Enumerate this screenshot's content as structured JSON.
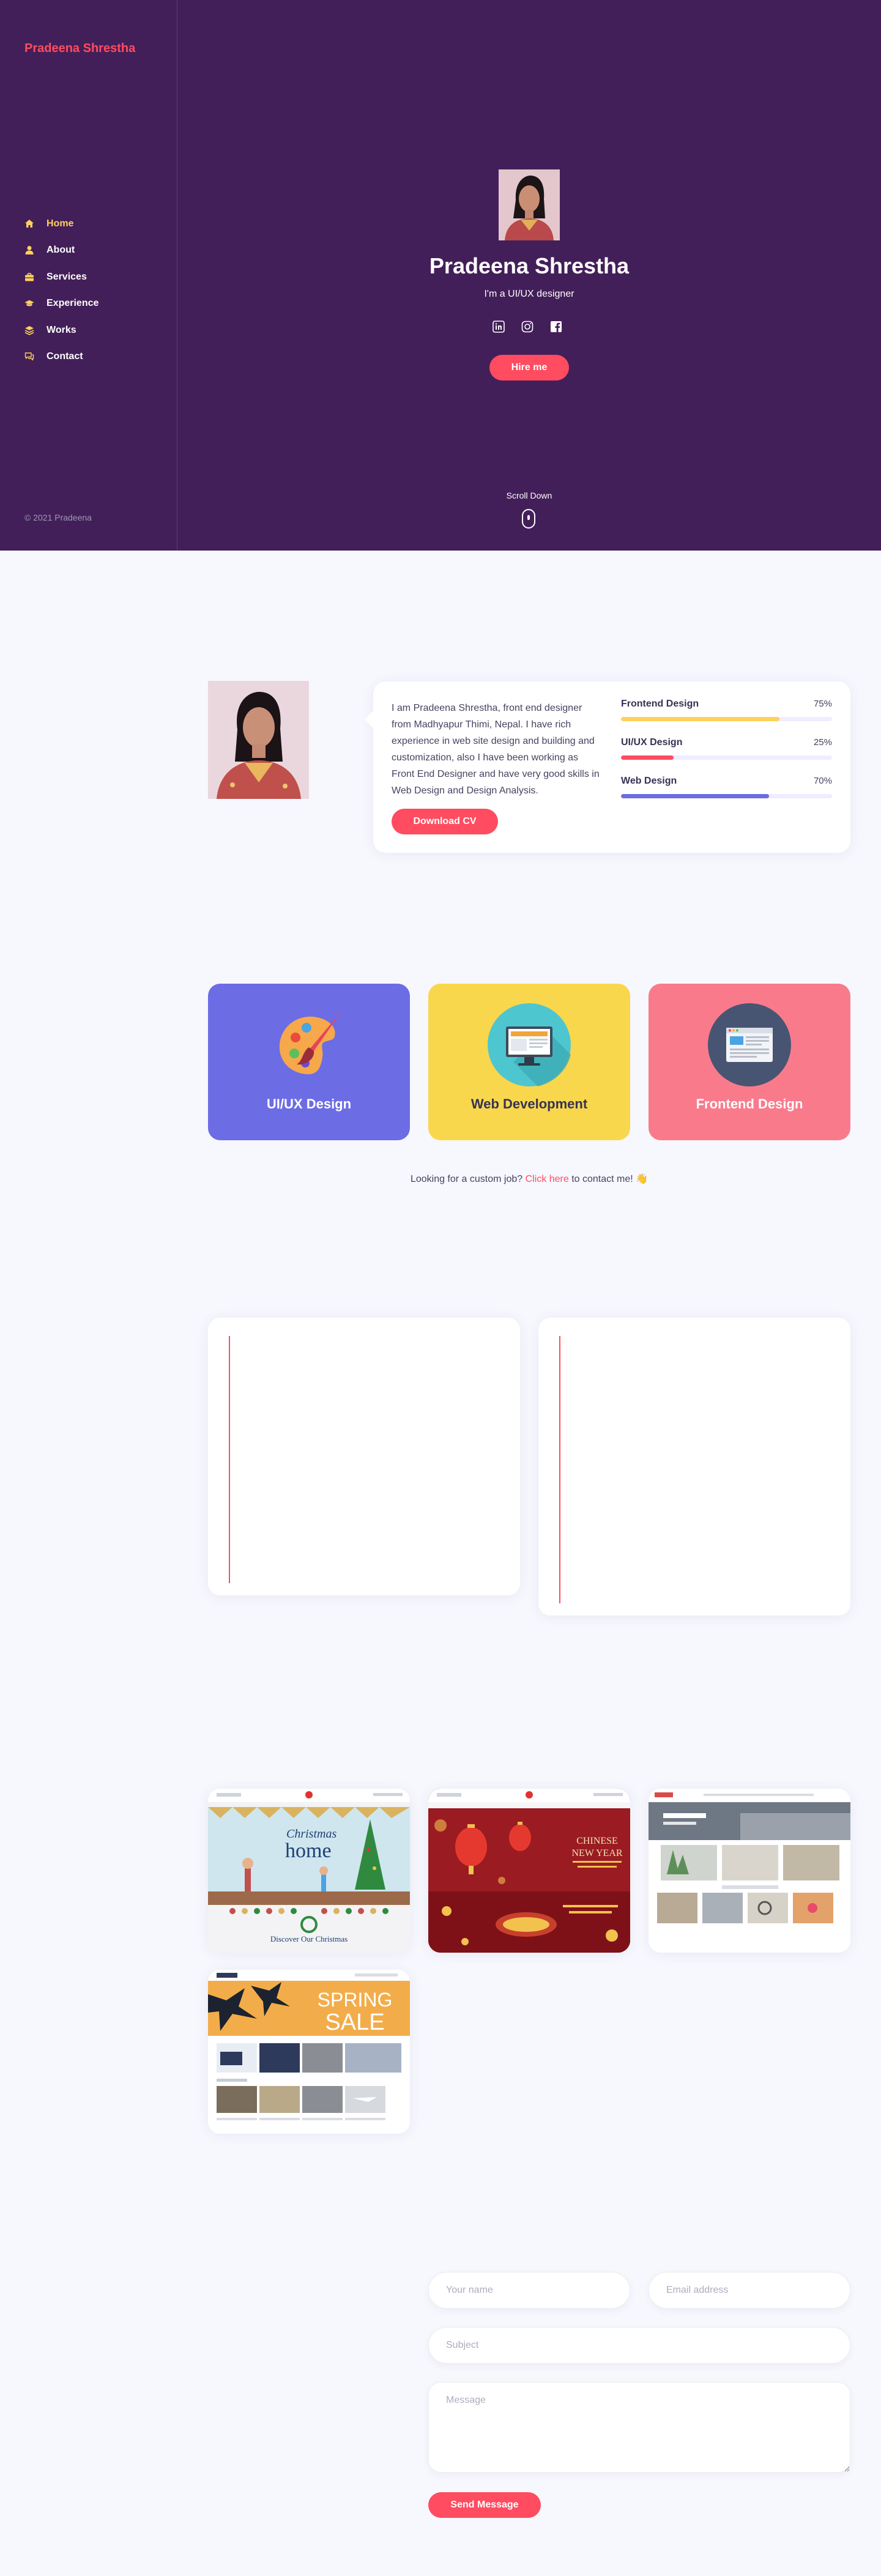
{
  "brand": "Pradeena Shrestha",
  "nav": [
    {
      "label": "Home",
      "icon": "home-icon",
      "active": true
    },
    {
      "label": "About",
      "icon": "user-icon"
    },
    {
      "label": "Services",
      "icon": "briefcase-icon"
    },
    {
      "label": "Experience",
      "icon": "graduation-cap-icon"
    },
    {
      "label": "Works",
      "icon": "layers-icon"
    },
    {
      "label": "Contact",
      "icon": "chat-icon"
    }
  ],
  "copyright": "© 2021 Pradeena",
  "hero": {
    "name": "Pradeena Shrestha",
    "subtitle": "I'm a UI/UX designer",
    "socials": [
      "linkedin-icon",
      "instagram-icon",
      "facebook-icon"
    ],
    "cta": "Hire me",
    "scroll": "Scroll Down"
  },
  "about": {
    "text": "I am Pradeena Shrestha, front end designer from Madhyapur Thimi, Nepal. I have rich experience in web site design and building and customization, also I have been working as Front End Designer and have very good skills in Web Design and Design Analysis.",
    "download": "Download CV",
    "skills": [
      {
        "name": "Frontend Design",
        "pct_label": "75%",
        "value": 75,
        "color": "#ffd15c"
      },
      {
        "name": "UI/UX Design",
        "pct_label": "25%",
        "value": 25,
        "color": "#ff4c60"
      },
      {
        "name": "Web Design",
        "pct_label": "70%",
        "value": 70,
        "color": "#6c6ce5"
      }
    ]
  },
  "services": [
    {
      "title": "UI/UX Design",
      "icon": "palette-icon",
      "bg": "#6c6ce5",
      "fg": "#ffffff"
    },
    {
      "title": "Web Development",
      "icon": "monitor-icon",
      "bg": "#f9d74c",
      "fg": "#353353"
    },
    {
      "title": "Frontend Design",
      "icon": "browser-window-icon",
      "bg": "#f97b8b",
      "fg": "#ffffff"
    }
  ],
  "custom_job": {
    "before": "Looking for a custom job? ",
    "link": "Click here",
    "after": " to contact me! 👋"
  },
  "contact": {
    "name_placeholder": "Your name",
    "email_placeholder": "Email address",
    "subject_placeholder": "Subject",
    "message_placeholder": "Message",
    "send": "Send Message"
  },
  "works": [
    {
      "theme": "christmas",
      "thumb_title_1": "Christmas",
      "thumb_title_2": "home",
      "thumb_caption": "Discover Our Christmas"
    },
    {
      "theme": "chinese-new-year",
      "thumb_title_1": "CHINESE",
      "thumb_title_2": "NEW YEAR"
    },
    {
      "theme": "home-products"
    },
    {
      "theme": "spring-sale",
      "thumb_title_1": "SPRING",
      "thumb_title_2": "SALE"
    }
  ]
}
